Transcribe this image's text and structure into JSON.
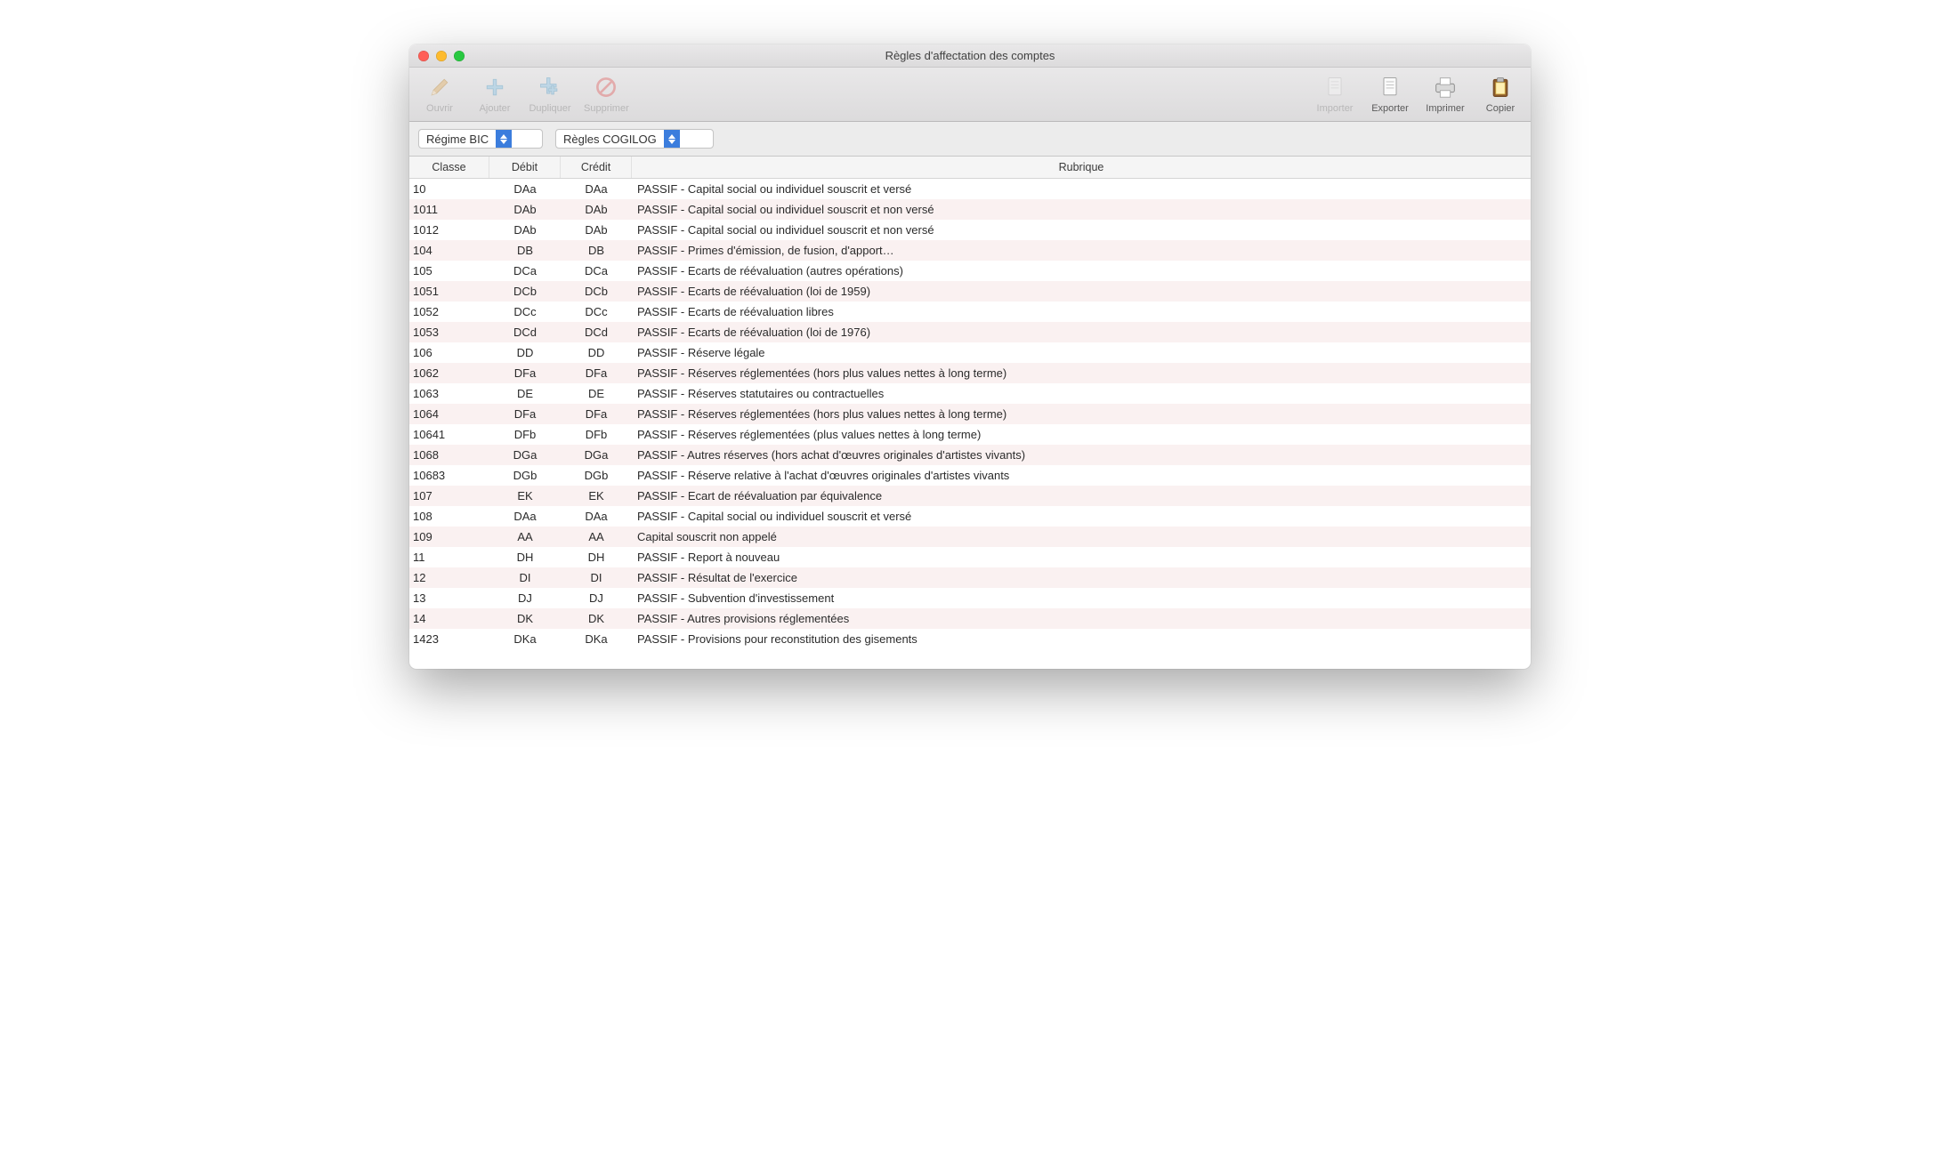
{
  "window": {
    "title": "Règles d'affectation des comptes"
  },
  "toolbar": {
    "left": [
      {
        "name": "ouvrir",
        "icon": "pencil-icon",
        "label": "Ouvrir",
        "disabled": true
      },
      {
        "name": "ajouter",
        "icon": "plus-icon",
        "label": "Ajouter",
        "disabled": true
      },
      {
        "name": "dupliquer",
        "icon": "plus-dup-icon",
        "label": "Dupliquer",
        "disabled": true
      },
      {
        "name": "supprimer",
        "icon": "forbidden-icon",
        "label": "Supprimer",
        "disabled": true
      }
    ],
    "right": [
      {
        "name": "importer",
        "icon": "doc-import-icon",
        "label": "Importer",
        "disabled": true
      },
      {
        "name": "exporter",
        "icon": "doc-export-icon",
        "label": "Exporter",
        "disabled": false
      },
      {
        "name": "imprimer",
        "icon": "printer-icon",
        "label": "Imprimer",
        "disabled": false
      },
      {
        "name": "copier",
        "icon": "clipboard-icon",
        "label": "Copier",
        "disabled": false
      }
    ]
  },
  "filters": {
    "regime": "Régime BIC",
    "ruleset": "Règles COGILOG"
  },
  "table": {
    "columns": {
      "classe": "Classe",
      "debit": "Débit",
      "credit": "Crédit",
      "rubrique": "Rubrique"
    },
    "rows": [
      {
        "classe": "10",
        "debit": "DAa",
        "credit": "DAa",
        "rubrique": "PASSIF - Capital social ou individuel souscrit et versé"
      },
      {
        "classe": "1011",
        "debit": "DAb",
        "credit": "DAb",
        "rubrique": "PASSIF - Capital social ou individuel souscrit et non versé"
      },
      {
        "classe": "1012",
        "debit": "DAb",
        "credit": "DAb",
        "rubrique": "PASSIF - Capital social ou individuel souscrit et non versé"
      },
      {
        "classe": "104",
        "debit": "DB",
        "credit": "DB",
        "rubrique": "PASSIF - Primes d'émission, de fusion, d'apport…"
      },
      {
        "classe": "105",
        "debit": "DCa",
        "credit": "DCa",
        "rubrique": "PASSIF - Ecarts de réévaluation (autres opérations)"
      },
      {
        "classe": "1051",
        "debit": "DCb",
        "credit": "DCb",
        "rubrique": "PASSIF - Ecarts de réévaluation (loi de 1959)"
      },
      {
        "classe": "1052",
        "debit": "DCc",
        "credit": "DCc",
        "rubrique": "PASSIF - Ecarts de réévaluation libres"
      },
      {
        "classe": "1053",
        "debit": "DCd",
        "credit": "DCd",
        "rubrique": "PASSIF - Ecarts de réévaluation (loi de 1976)"
      },
      {
        "classe": "106",
        "debit": "DD",
        "credit": "DD",
        "rubrique": "PASSIF - Réserve légale"
      },
      {
        "classe": "1062",
        "debit": "DFa",
        "credit": "DFa",
        "rubrique": "PASSIF - Réserves réglementées (hors plus values nettes à long terme)"
      },
      {
        "classe": "1063",
        "debit": "DE",
        "credit": "DE",
        "rubrique": "PASSIF - Réserves statutaires ou contractuelles"
      },
      {
        "classe": "1064",
        "debit": "DFa",
        "credit": "DFa",
        "rubrique": "PASSIF - Réserves réglementées (hors plus values nettes à long terme)"
      },
      {
        "classe": "10641",
        "debit": "DFb",
        "credit": "DFb",
        "rubrique": "PASSIF - Réserves réglementées (plus values nettes à long terme)"
      },
      {
        "classe": "1068",
        "debit": "DGa",
        "credit": "DGa",
        "rubrique": "PASSIF - Autres réserves (hors achat d'œuvres originales d'artistes vivants)"
      },
      {
        "classe": "10683",
        "debit": "DGb",
        "credit": "DGb",
        "rubrique": "PASSIF - Réserve relative à l'achat d'œuvres originales d'artistes vivants"
      },
      {
        "classe": "107",
        "debit": "EK",
        "credit": "EK",
        "rubrique": "PASSIF - Ecart de réévaluation par équivalence"
      },
      {
        "classe": "108",
        "debit": "DAa",
        "credit": "DAa",
        "rubrique": "PASSIF - Capital social ou individuel souscrit et versé"
      },
      {
        "classe": "109",
        "debit": "AA",
        "credit": "AA",
        "rubrique": "Capital souscrit non appelé"
      },
      {
        "classe": "11",
        "debit": "DH",
        "credit": "DH",
        "rubrique": "PASSIF - Report à nouveau"
      },
      {
        "classe": "12",
        "debit": "DI",
        "credit": "DI",
        "rubrique": "PASSIF - Résultat de l'exercice"
      },
      {
        "classe": "13",
        "debit": "DJ",
        "credit": "DJ",
        "rubrique": "PASSIF - Subvention d'investissement"
      },
      {
        "classe": "14",
        "debit": "DK",
        "credit": "DK",
        "rubrique": "PASSIF - Autres provisions réglementées"
      },
      {
        "classe": "1423",
        "debit": "DKa",
        "credit": "DKa",
        "rubrique": "PASSIF - Provisions pour reconstitution des gisements"
      }
    ]
  }
}
